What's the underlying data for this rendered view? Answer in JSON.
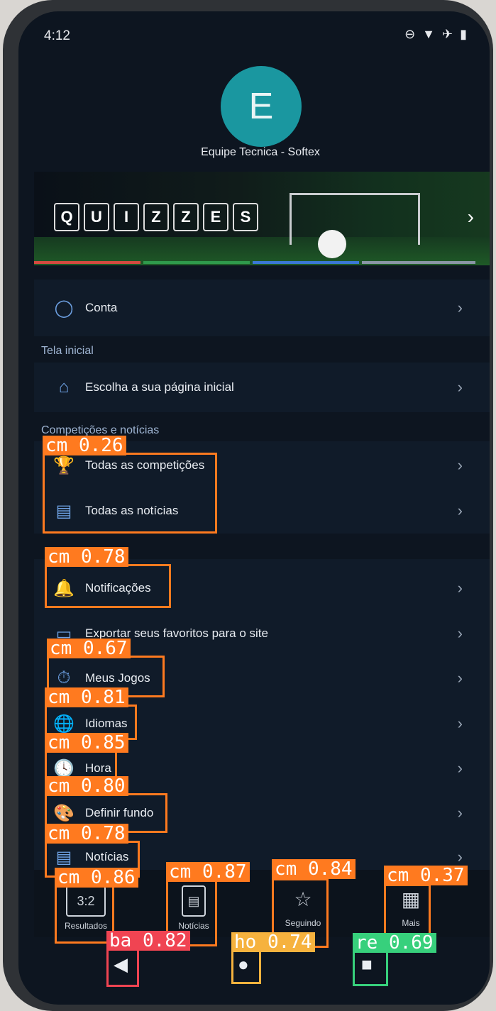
{
  "status": {
    "time": "4:12"
  },
  "profile": {
    "initial": "E",
    "name": "Equipe Tecnica - Softex"
  },
  "banner": {
    "word": [
      "Q",
      "U",
      "I",
      "Z",
      "Z",
      "E",
      "S"
    ],
    "next_icon": "chevron-right-icon"
  },
  "settings": {
    "conta": "Conta",
    "section_home": "Tela inicial",
    "home_choice": "Escolha a sua página inicial",
    "section_comp": "Competições e notícias",
    "all_comp": "Todas as competições",
    "all_news": "Todas as notícias",
    "notifications": "Notificações",
    "export_fav": "Exportar seus favoritos para o site",
    "my_games": "Meus Jogos",
    "languages": "Idiomas",
    "time": "Hora",
    "background": "Definir fundo",
    "news": "Notícias"
  },
  "bottom_nav": {
    "results": "Resultados",
    "results_icon": "3:2",
    "news": "Notícias",
    "following": "Seguindo",
    "more": "Mais"
  },
  "detections": [
    {
      "label": "cm 0.26"
    },
    {
      "label": "cm 0.78"
    },
    {
      "label": "cm 0.67"
    },
    {
      "label": "cm 0.81"
    },
    {
      "label": "cm 0.85"
    },
    {
      "label": "cm 0.80"
    },
    {
      "label": "cm 0.78"
    },
    {
      "label": "cm 0.86"
    },
    {
      "label": "cm 0.87"
    },
    {
      "label": "cm 0.84"
    },
    {
      "label": "cm 0.37"
    },
    {
      "label": "ba 0.82"
    },
    {
      "label": "ho 0.74"
    },
    {
      "label": "re 0.69"
    }
  ],
  "colors": {
    "accent": "#6fa3e6",
    "box_orange": "#ff7a1f",
    "box_red": "#f04452",
    "box_yellow": "#f6b23e",
    "box_green": "#37d07c"
  }
}
